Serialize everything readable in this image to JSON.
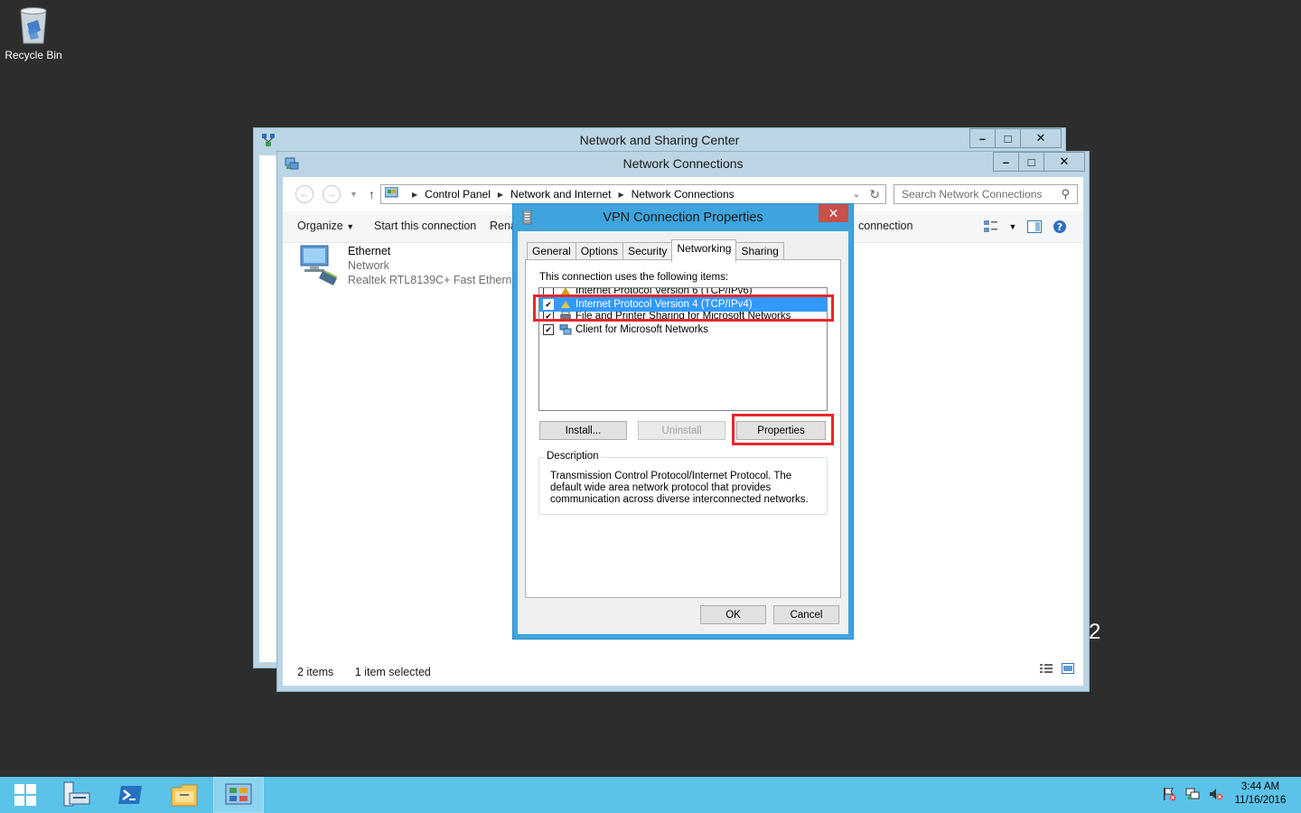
{
  "desktop": {
    "recycle_bin_label": "Recycle Bin",
    "stray_digit": "2"
  },
  "nsc_window": {
    "title": "Network and Sharing Center",
    "controls": [
      "–",
      "□",
      "✕"
    ]
  },
  "nc_window": {
    "title": "Network Connections",
    "controls": [
      "–",
      "□",
      "✕"
    ],
    "breadcrumb": [
      "Control Panel",
      "Network and Internet",
      "Network Connections"
    ],
    "search_placeholder": "Search Network Connections",
    "command_bar": {
      "organize": "Organize",
      "start_connection": "Start this connection",
      "rename_partial": "Rena",
      "connection_partial": "connection"
    },
    "adapter": {
      "name": "Ethernet",
      "type": "Network",
      "device": "Realtek RTL8139C+ Fast Ethernet ..."
    },
    "status": {
      "count": "2 items",
      "selected": "1 item selected"
    }
  },
  "vpn_dialog": {
    "title": "VPN Connection Properties",
    "close": "✕",
    "tabs": [
      "General",
      "Options",
      "Security",
      "Networking",
      "Sharing"
    ],
    "active_tab": "Networking",
    "items_label": "This connection uses the following items:",
    "items": [
      {
        "label": "Internet Protocol Version 6 (TCP/IPv6)",
        "checked": false
      },
      {
        "label": "Internet Protocol Version 4 (TCP/IPv4)",
        "checked": true,
        "selected": true
      },
      {
        "label": "File and Printer Sharing for Microsoft Networks",
        "checked": true
      },
      {
        "label": "Client for Microsoft Networks",
        "checked": true
      }
    ],
    "check_mark": "✔",
    "buttons": {
      "install": "Install...",
      "uninstall": "Uninstall",
      "properties": "Properties",
      "ok": "OK",
      "cancel": "Cancel"
    },
    "description_legend": "Description",
    "description_text": "Transmission Control Protocol/Internet Protocol. The default wide area network protocol that provides communication across diverse interconnected networks."
  },
  "taskbar": {
    "time": "3:44 AM",
    "date": "11/16/2016",
    "apps": [
      "start-icon",
      "server-manager-icon",
      "powershell-icon",
      "file-explorer-icon",
      "control-panel-icon"
    ]
  },
  "colors": {
    "desktop": "#2d2d2d",
    "taskbar": "#5bc3ea",
    "dialog_frame": "#3ea4dd",
    "highlight_box": "#e8262d",
    "selection": "#3399ff"
  }
}
